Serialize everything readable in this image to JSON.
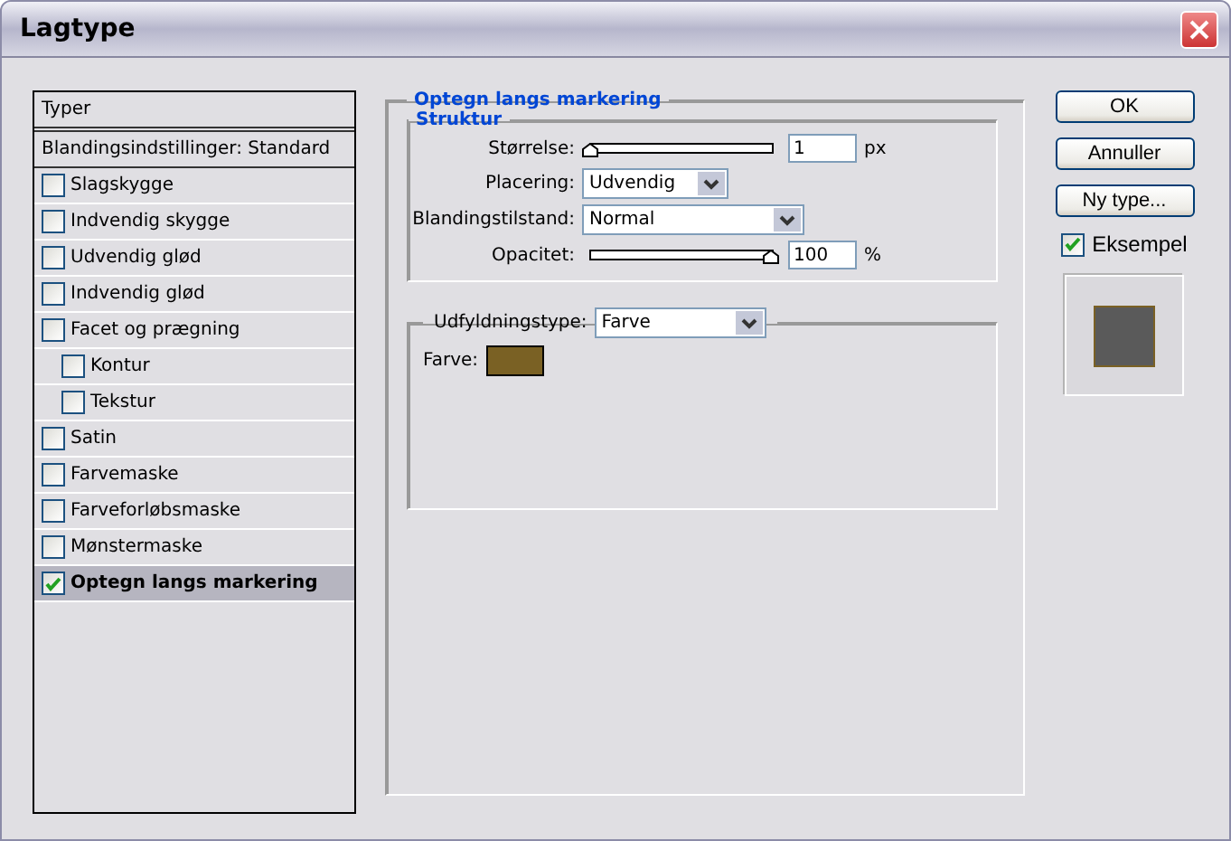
{
  "window": {
    "title": "Lagtype"
  },
  "sidebar": {
    "header": "Typer",
    "blend": "Blandingsindstillinger: Standard",
    "items": [
      {
        "label": "Slagskygge",
        "checked": false,
        "selected": false
      },
      {
        "label": "Indvendig skygge",
        "checked": false,
        "selected": false
      },
      {
        "label": "Udvendig glød",
        "checked": false,
        "selected": false
      },
      {
        "label": "Indvendig glød",
        "checked": false,
        "selected": false
      },
      {
        "label": "Facet og prægning",
        "checked": false,
        "selected": false,
        "children": [
          {
            "label": "Kontur",
            "checked": false,
            "selected": false
          },
          {
            "label": "Tekstur",
            "checked": false,
            "selected": false
          }
        ]
      },
      {
        "label": "Satin",
        "checked": false,
        "selected": false
      },
      {
        "label": "Farvemaske",
        "checked": false,
        "selected": false
      },
      {
        "label": "Farveforløbsmaske",
        "checked": false,
        "selected": false
      },
      {
        "label": "Mønstermaske",
        "checked": false,
        "selected": false
      },
      {
        "label": "Optegn langs markering",
        "checked": true,
        "selected": true
      }
    ]
  },
  "panel": {
    "title": "Optegn langs markering",
    "structure": {
      "title": "Struktur",
      "rows": [
        {
          "kind": "slider",
          "label": "Størrelse:",
          "level": 0,
          "value": "1",
          "unit": "px"
        },
        {
          "kind": "select",
          "label": "Placering:",
          "value": "Udvendig",
          "wide": false
        },
        {
          "kind": "select",
          "label": "Blandingstilstand:",
          "value": "Normal",
          "wide": true
        },
        {
          "kind": "slider",
          "label": "Opacitet:",
          "level": 1,
          "value": "100",
          "unit": "%"
        }
      ]
    },
    "fill": {
      "label": "Udfyldningstype:",
      "value": "Farve",
      "color_label": "Farve:",
      "color": "#7a6124"
    }
  },
  "buttons": [
    "OK",
    "Annuller",
    "Ny type..."
  ],
  "preview": {
    "label": "Eksempel",
    "checked": true
  }
}
